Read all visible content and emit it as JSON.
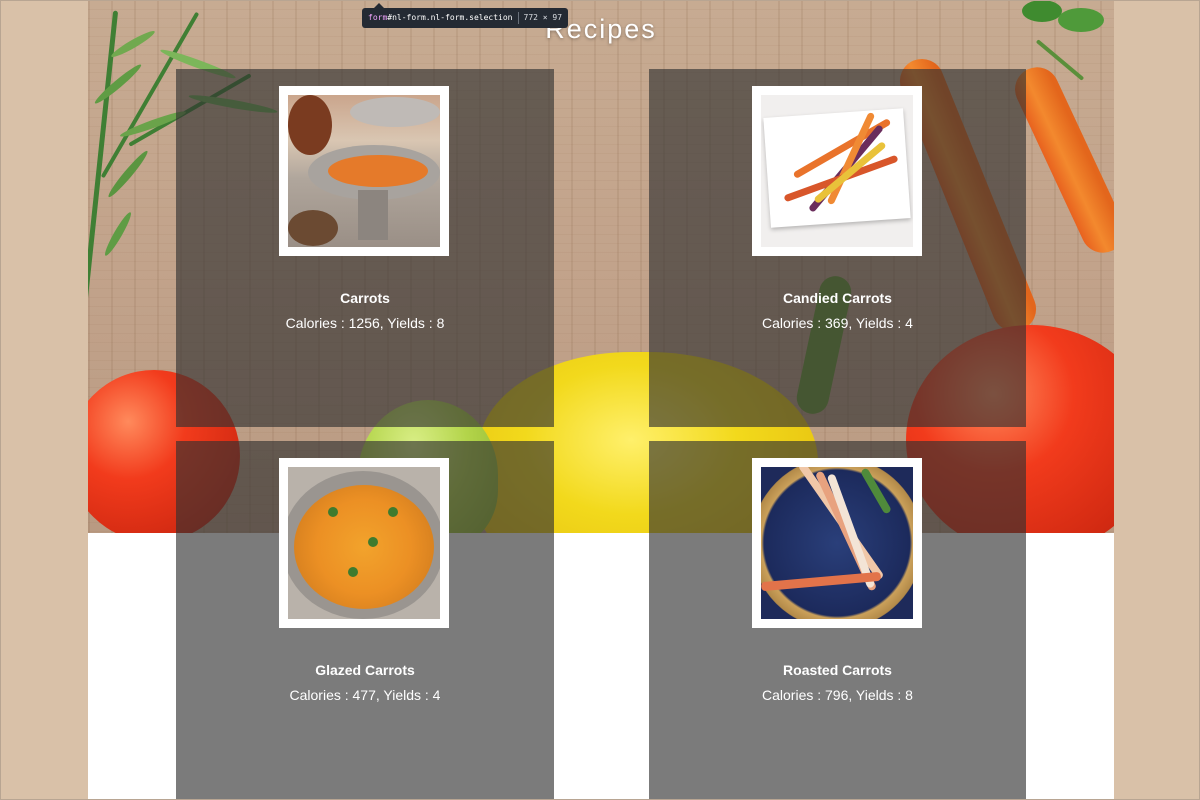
{
  "page": {
    "title": "Recipes"
  },
  "devtools_tooltip": {
    "selector_prefix": "form",
    "selector_rest": "#nl-form.nl-form.selection",
    "dimensions": "772 × 97"
  },
  "recipes": [
    {
      "name": "Carrots",
      "stats": "Calories : 1256, Yields : 8",
      "image_icon": "carrot-dish-photo"
    },
    {
      "name": "Candied Carrots",
      "stats": "Calories : 369, Yields : 4",
      "image_icon": "carrot-dish-photo"
    },
    {
      "name": "Glazed Carrots",
      "stats": "Calories : 477, Yields : 4",
      "image_icon": "carrot-dish-photo"
    },
    {
      "name": "Roasted Carrots",
      "stats": "Calories : 796, Yields : 8",
      "image_icon": "carrot-dish-photo"
    }
  ],
  "colors": {
    "page_margin": "#d9c1a8",
    "card_overlay": "rgba(48,48,48,0.64)",
    "text": "#ffffff"
  }
}
